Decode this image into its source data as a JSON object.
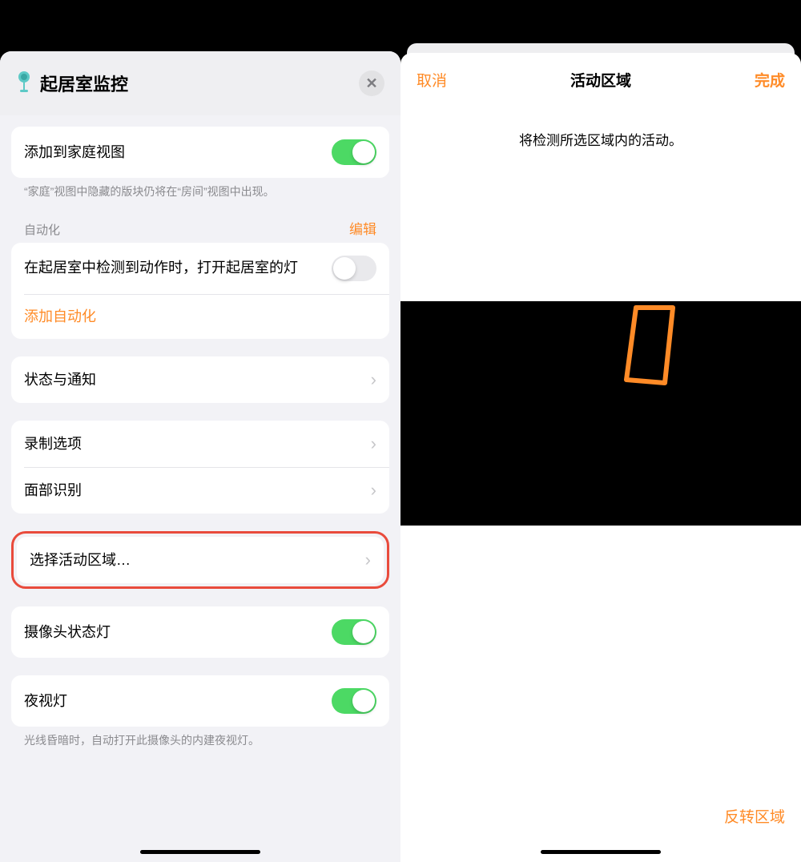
{
  "left": {
    "header": {
      "title": "起居室监控"
    },
    "groups": {
      "include_home": {
        "label": "添加到家庭视图",
        "toggle_on": true,
        "footnote": "“家庭”视图中隐藏的版块仍将在“房间”视图中出现。"
      },
      "automation": {
        "header_label": "自动化",
        "edit_label": "编辑",
        "rule_label": "在起居室中检测到动作时，打开起居室的灯",
        "rule_toggle_on": false,
        "add_label": "添加自动化"
      },
      "status_notify": {
        "label": "状态与通知"
      },
      "recording": {
        "record_label": "录制选项",
        "face_label": "面部识别"
      },
      "activity_zone": {
        "label": "选择活动区域…"
      },
      "camera_led": {
        "label": "摄像头状态灯",
        "toggle_on": true
      },
      "night_vision": {
        "label": "夜视灯",
        "toggle_on": true,
        "footnote": "光线昏暗时，自动打开此摄像头的内建夜视灯。"
      }
    }
  },
  "right": {
    "nav": {
      "cancel_label": "取消",
      "title": "活动区域",
      "done_label": "完成"
    },
    "description": "将检测所选区域内的活动。",
    "invert_label": "反转区域"
  },
  "colors": {
    "accent": "#ff8b27",
    "toggle_green": "#4cd964",
    "highlight": "#e94b3c"
  }
}
